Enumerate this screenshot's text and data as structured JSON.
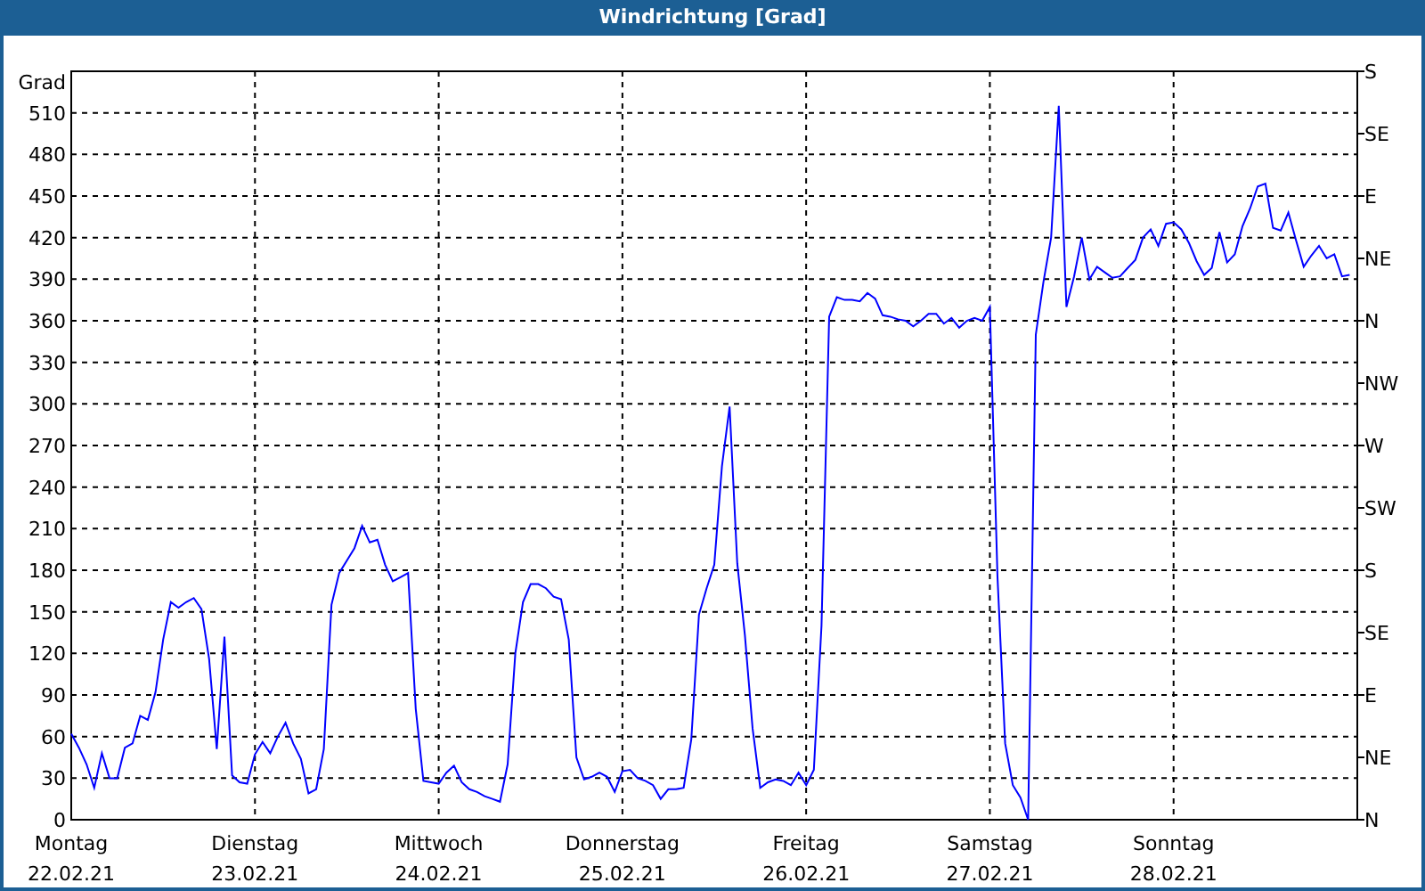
{
  "window": {
    "title": "Windrichtung [Grad]"
  },
  "chart": {
    "chart_data": {
      "type": "line",
      "grid": true,
      "ylabel": "Grad",
      "ylim": [
        0,
        540
      ],
      "yticks": [
        0,
        30,
        60,
        90,
        120,
        150,
        180,
        210,
        240,
        270,
        300,
        330,
        360,
        390,
        420,
        450,
        480,
        510
      ],
      "categories": [
        "Montag\n22.02.21",
        null,
        null,
        null,
        null,
        null,
        null,
        null,
        null,
        null,
        null,
        null,
        null,
        null,
        null,
        null,
        null,
        null,
        null,
        null,
        null,
        null,
        null,
        null,
        "Dienstag\n23.02.21",
        null,
        null,
        null,
        null,
        null,
        null,
        null,
        null,
        null,
        null,
        null,
        null,
        null,
        null,
        null,
        null,
        null,
        null,
        null,
        null,
        null,
        null,
        null,
        "Mittwoch\n24.02.21",
        null,
        null,
        null,
        null,
        null,
        null,
        null,
        null,
        null,
        null,
        null,
        null,
        null,
        null,
        null,
        null,
        null,
        null,
        null,
        null,
        null,
        null,
        null,
        "Donnerstag\n25.02.21",
        null,
        null,
        null,
        null,
        null,
        null,
        null,
        null,
        null,
        null,
        null,
        null,
        null,
        null,
        null,
        null,
        null,
        null,
        null,
        null,
        null,
        null,
        null,
        "Freitag\n26.02.21",
        null,
        null,
        null,
        null,
        null,
        null,
        null,
        null,
        null,
        null,
        null,
        null,
        null,
        null,
        null,
        null,
        null,
        null,
        null,
        null,
        null,
        null,
        null,
        "Samstag\n27.02.21",
        null,
        null,
        null,
        null,
        null,
        null,
        null,
        null,
        null,
        null,
        null,
        null,
        null,
        null,
        null,
        null,
        null,
        null,
        null,
        null,
        null,
        null,
        null,
        "Sonntag\n28.02.21",
        null,
        null,
        null,
        null,
        null,
        null,
        null,
        null,
        null,
        null,
        null,
        null,
        null,
        null,
        null,
        null,
        null,
        null,
        null,
        null,
        null,
        null,
        null
      ],
      "series": [
        {
          "color": "#0000ff",
          "values": [
            62,
            52,
            40,
            23,
            48,
            30,
            30,
            52,
            55,
            75,
            72,
            92,
            130,
            157,
            153,
            157,
            160,
            152,
            116,
            51,
            132,
            32,
            27,
            26,
            47,
            56,
            48,
            60,
            70,
            55,
            44,
            19,
            22,
            51,
            155,
            178,
            187,
            196,
            212,
            200,
            202,
            184,
            172,
            175,
            178,
            80,
            28,
            27,
            26,
            34,
            39,
            27,
            22,
            20,
            17,
            15,
            13,
            40,
            120,
            157,
            170,
            170,
            167,
            161,
            159,
            130,
            45,
            29,
            31,
            34,
            31,
            20,
            35,
            36,
            30,
            28,
            25,
            15,
            22,
            22,
            23,
            58,
            148,
            167,
            184,
            255,
            298,
            185,
            133,
            66,
            23,
            27,
            29,
            28,
            25,
            34,
            25,
            36,
            140,
            363,
            377,
            375,
            375,
            374,
            380,
            376,
            364,
            363,
            361,
            360,
            356,
            360,
            365,
            365,
            358,
            362,
            355,
            360,
            362,
            360,
            370,
            175,
            55,
            25,
            16,
            0,
            350,
            388,
            420,
            515,
            370,
            392,
            420,
            390,
            399,
            395,
            391,
            392,
            398,
            404,
            420,
            426,
            414,
            430,
            431,
            426,
            416,
            403,
            393,
            398,
            424,
            402,
            408,
            428,
            441,
            457,
            459,
            427,
            425,
            438,
            418,
            399,
            407,
            414,
            405,
            408,
            392,
            393
          ]
        }
      ]
    },
    "compass_labels": [
      "S",
      "SE",
      "E",
      "NE",
      "N",
      "NW",
      "W",
      "SW",
      "S",
      "SE",
      "E",
      "NE",
      "N"
    ]
  }
}
